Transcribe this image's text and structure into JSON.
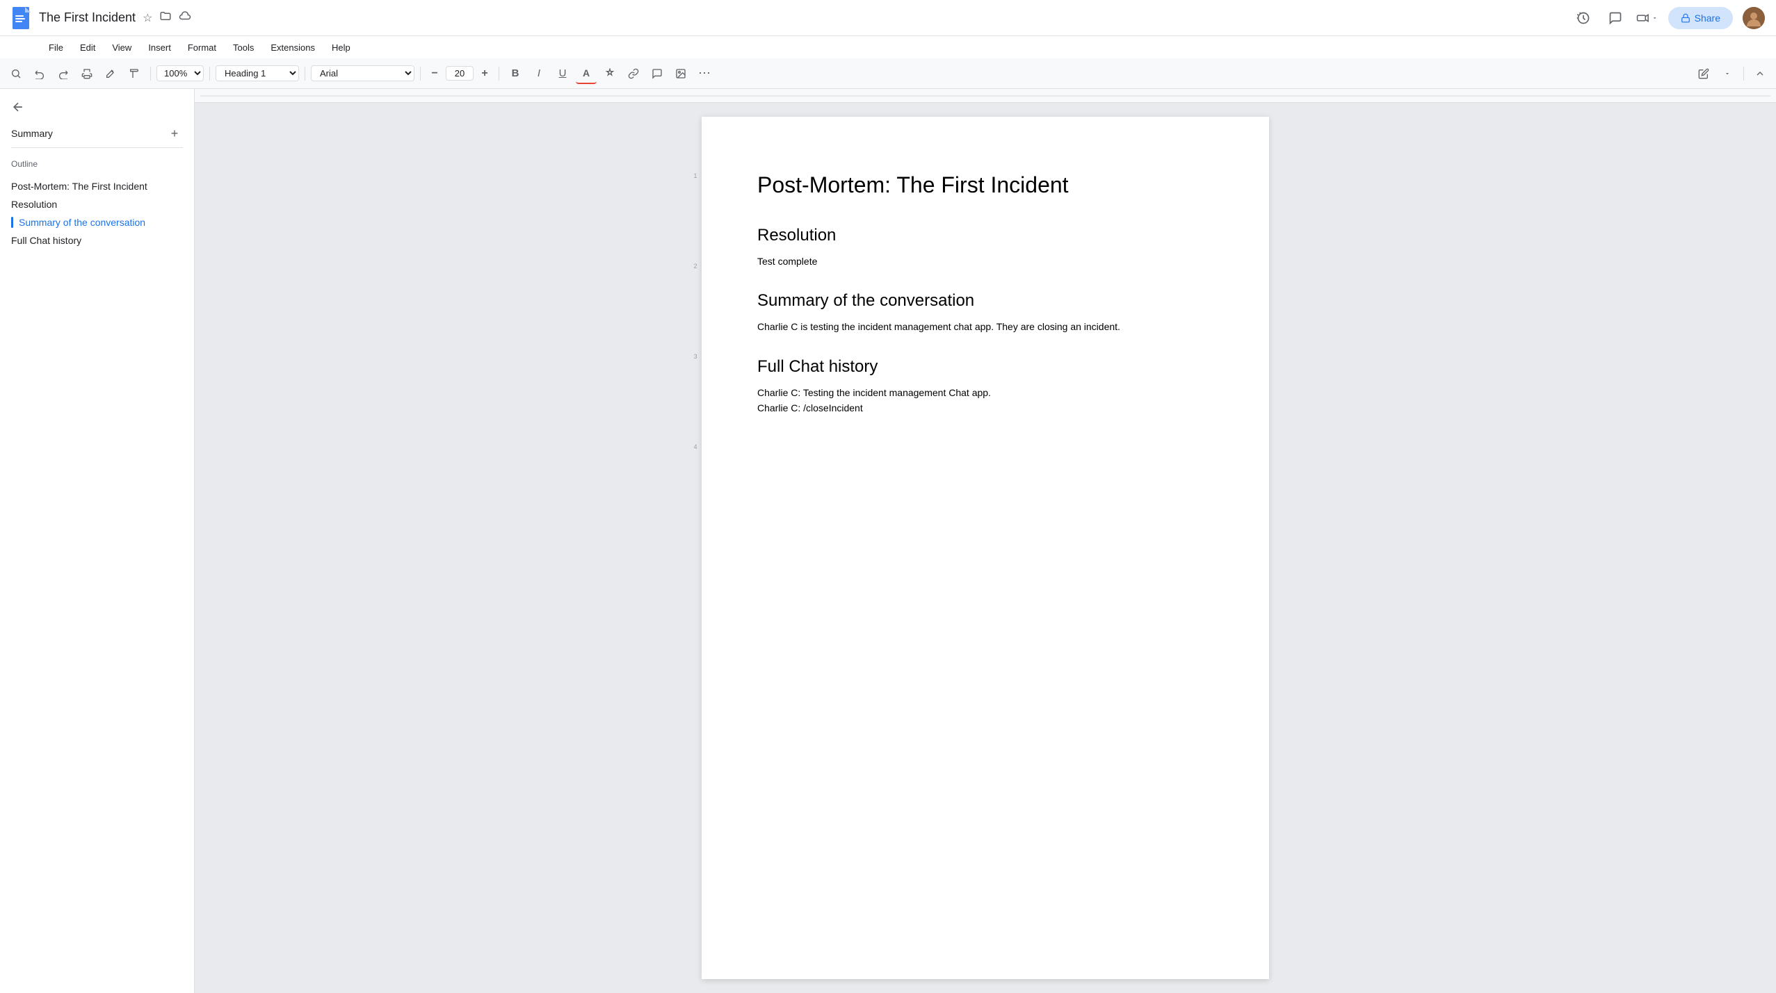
{
  "title_bar": {
    "doc_title": "The First Incident",
    "star_icon": "★",
    "folder_icon": "📁",
    "cloud_icon": "☁",
    "history_icon": "🕐",
    "comment_icon": "💬",
    "video_icon": "📹",
    "share_label": "Share",
    "share_icon": "🔒"
  },
  "menu": {
    "items": [
      "File",
      "Edit",
      "View",
      "Insert",
      "Format",
      "Tools",
      "Extensions",
      "Help"
    ]
  },
  "toolbar": {
    "zoom": "100%",
    "style": "Heading 1",
    "font": "Arial",
    "font_size": "20",
    "bold": "B",
    "italic": "I",
    "underline": "U",
    "text_color": "A",
    "highlight": "✏",
    "link": "🔗",
    "comment": "💬",
    "image": "🖼",
    "more": "⋯",
    "edit_icon": "✏",
    "collapse_icon": "∧"
  },
  "sidebar": {
    "back_icon": "←",
    "summary_label": "Summary",
    "add_icon": "+",
    "outline_label": "Outline",
    "outline_items": [
      {
        "text": "Post-Mortem: The First Incident",
        "active": false
      },
      {
        "text": "Resolution",
        "active": false
      },
      {
        "text": "Summary of the conversation",
        "active": true
      },
      {
        "text": "Full Chat history",
        "active": false
      }
    ]
  },
  "document": {
    "main_title": "Post-Mortem: The First Incident",
    "sections": [
      {
        "heading": "Resolution",
        "body": "Test complete"
      },
      {
        "heading": "Summary of the conversation",
        "body": "Charlie C is testing the incident management chat app. They are closing an incident."
      },
      {
        "heading": "Full Chat history",
        "body_lines": [
          "Charlie C: Testing the incident management Chat app.",
          "Charlie C: /closeIncident"
        ]
      }
    ]
  }
}
